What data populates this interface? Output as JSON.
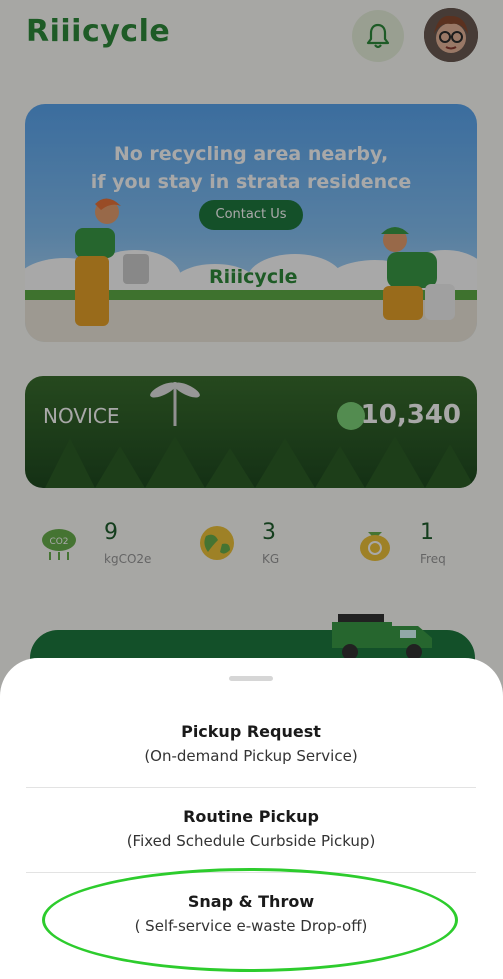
{
  "header": {
    "logo_text": "Riiicycle",
    "bell_icon": "bell-icon",
    "avatar": "avatar"
  },
  "banner": {
    "title_line1": "No recycling area nearby,",
    "title_line2": "if you stay in strata residence",
    "contact_button": "Contact Us",
    "logo_text": "Riiicycle"
  },
  "tier": {
    "name": "NOVICE",
    "points": "10,340",
    "icon": "alien-icon"
  },
  "stats": [
    {
      "value": "9",
      "unit": "kgCO2e",
      "icon": "co2-cloud-icon"
    },
    {
      "value": "3",
      "unit": "KG",
      "icon": "earth-icon"
    },
    {
      "value": "1",
      "unit": "Freq",
      "icon": "recycle-bag-icon"
    }
  ],
  "sheet": {
    "options": [
      {
        "title": "Pickup Request",
        "subtitle": "(On-demand Pickup Service)"
      },
      {
        "title": "Routine Pickup",
        "subtitle": "(Fixed Schedule Curbside Pickup)"
      },
      {
        "title": "Snap & Throw",
        "subtitle": "( Self-service e-waste Drop-off)"
      }
    ]
  },
  "colors": {
    "brand_green": "#2e8b3a",
    "highlight_ellipse": "#2dcc2d",
    "overlay": "rgba(0,0,0,0.34)"
  }
}
